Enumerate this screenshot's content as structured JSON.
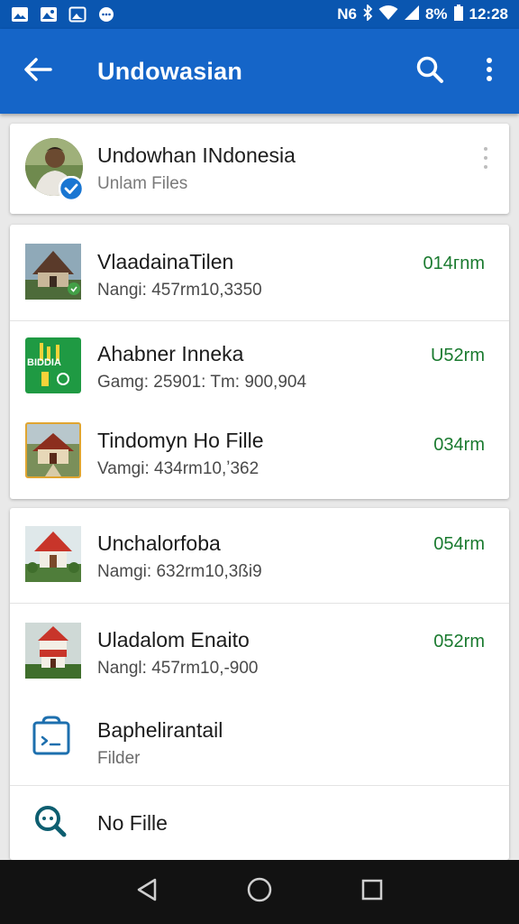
{
  "status_bar": {
    "network_label": "N6",
    "battery_percent": "8%",
    "time": "12:28",
    "icons": [
      "gallery-icon",
      "image-icon",
      "photo-icon",
      "chat-icon",
      "bluetooth-icon",
      "wifi-icon",
      "signal-icon",
      "battery-icon"
    ]
  },
  "app_bar": {
    "title": "Undowasian",
    "back_icon": "arrow-left-icon",
    "search_icon": "search-icon",
    "more_icon": "more-vert-icon"
  },
  "account": {
    "name": "Undowhan INdonesia",
    "subtitle": "Unlam Files",
    "badge": "verified-check-icon"
  },
  "files_group_1": [
    {
      "name": "VlaadainaTilen",
      "meta": "Nangi: 457rm10,3350",
      "duration": "014гnm"
    },
    {
      "name": "Ahabner Inneka",
      "meta": "Gamg: 25901: Tm: 900,904",
      "duration": "U52rm"
    },
    {
      "name": "Tindomyn Ho Fille",
      "meta": "Vamgi: 434rm10,ʼ362",
      "duration": "034rm"
    }
  ],
  "thumb_labels": {
    "indonesia_card": "BIDDIA"
  },
  "files_group_2": [
    {
      "name": "Unchalorfoba",
      "meta": "Namgi: 632rm10,3ßi9",
      "duration": "054rm"
    },
    {
      "name": "Uladalom Enaito",
      "meta": "Nangl: 457rm10,-900",
      "duration": "052rm"
    },
    {
      "name": "Baphelirantail",
      "meta": "Filder",
      "duration": ""
    },
    {
      "name": "No Fille",
      "meta": "",
      "duration": ""
    }
  ],
  "colors": {
    "status_bar": "#0a56b0",
    "app_bar": "#1565c8",
    "duration_green": "#1a7a2f",
    "nav_bar": "#121212",
    "folder_icon": "#1d6fae"
  },
  "nav_bar": {
    "buttons": [
      "back-triangle-icon",
      "home-circle-icon",
      "recents-square-icon"
    ]
  }
}
